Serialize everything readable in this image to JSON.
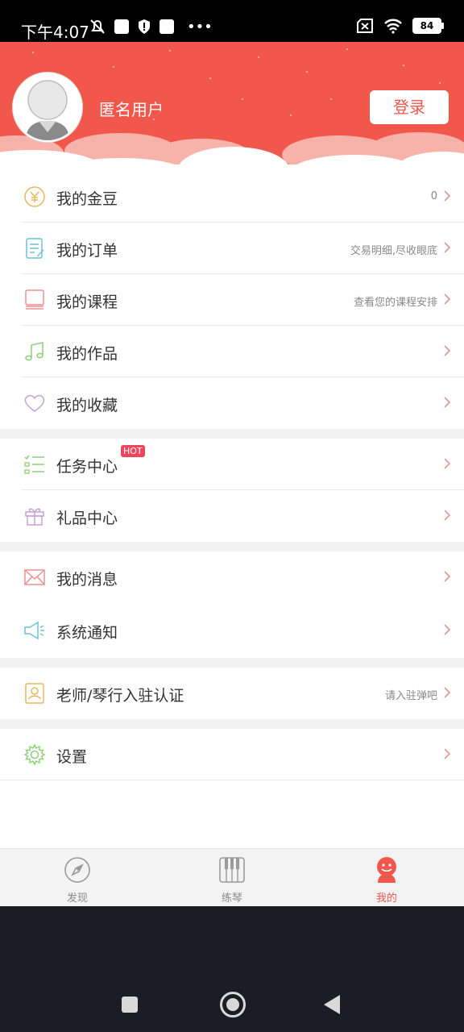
{
  "status_bar": {
    "time": "下午4:07",
    "battery": "84"
  },
  "profile": {
    "username": "匿名用户",
    "login_label": "登录"
  },
  "menu": {
    "gold_beans": {
      "label": "我的金豆",
      "hint": "0"
    },
    "orders": {
      "label": "我的订单",
      "hint": "交易明细,尽收眼底"
    },
    "courses": {
      "label": "我的课程",
      "hint": "查看您的课程安排"
    },
    "works": {
      "label": "我的作品",
      "hint": ""
    },
    "favorites": {
      "label": "我的收藏",
      "hint": ""
    },
    "tasks": {
      "label": "任务中心",
      "badge": "HOT"
    },
    "gifts": {
      "label": "礼品中心"
    },
    "messages": {
      "label": "我的消息"
    },
    "notices": {
      "label": "系统通知"
    },
    "certify": {
      "label": "老师/琴行入驻认证",
      "hint": "请入驻弹吧"
    },
    "settings": {
      "label": "设置"
    }
  },
  "tabbar": {
    "discover": "发现",
    "practice": "练琴",
    "mine": "我的"
  },
  "colors": {
    "accent": "#f2574b",
    "hot_badge": "#f0445a"
  }
}
